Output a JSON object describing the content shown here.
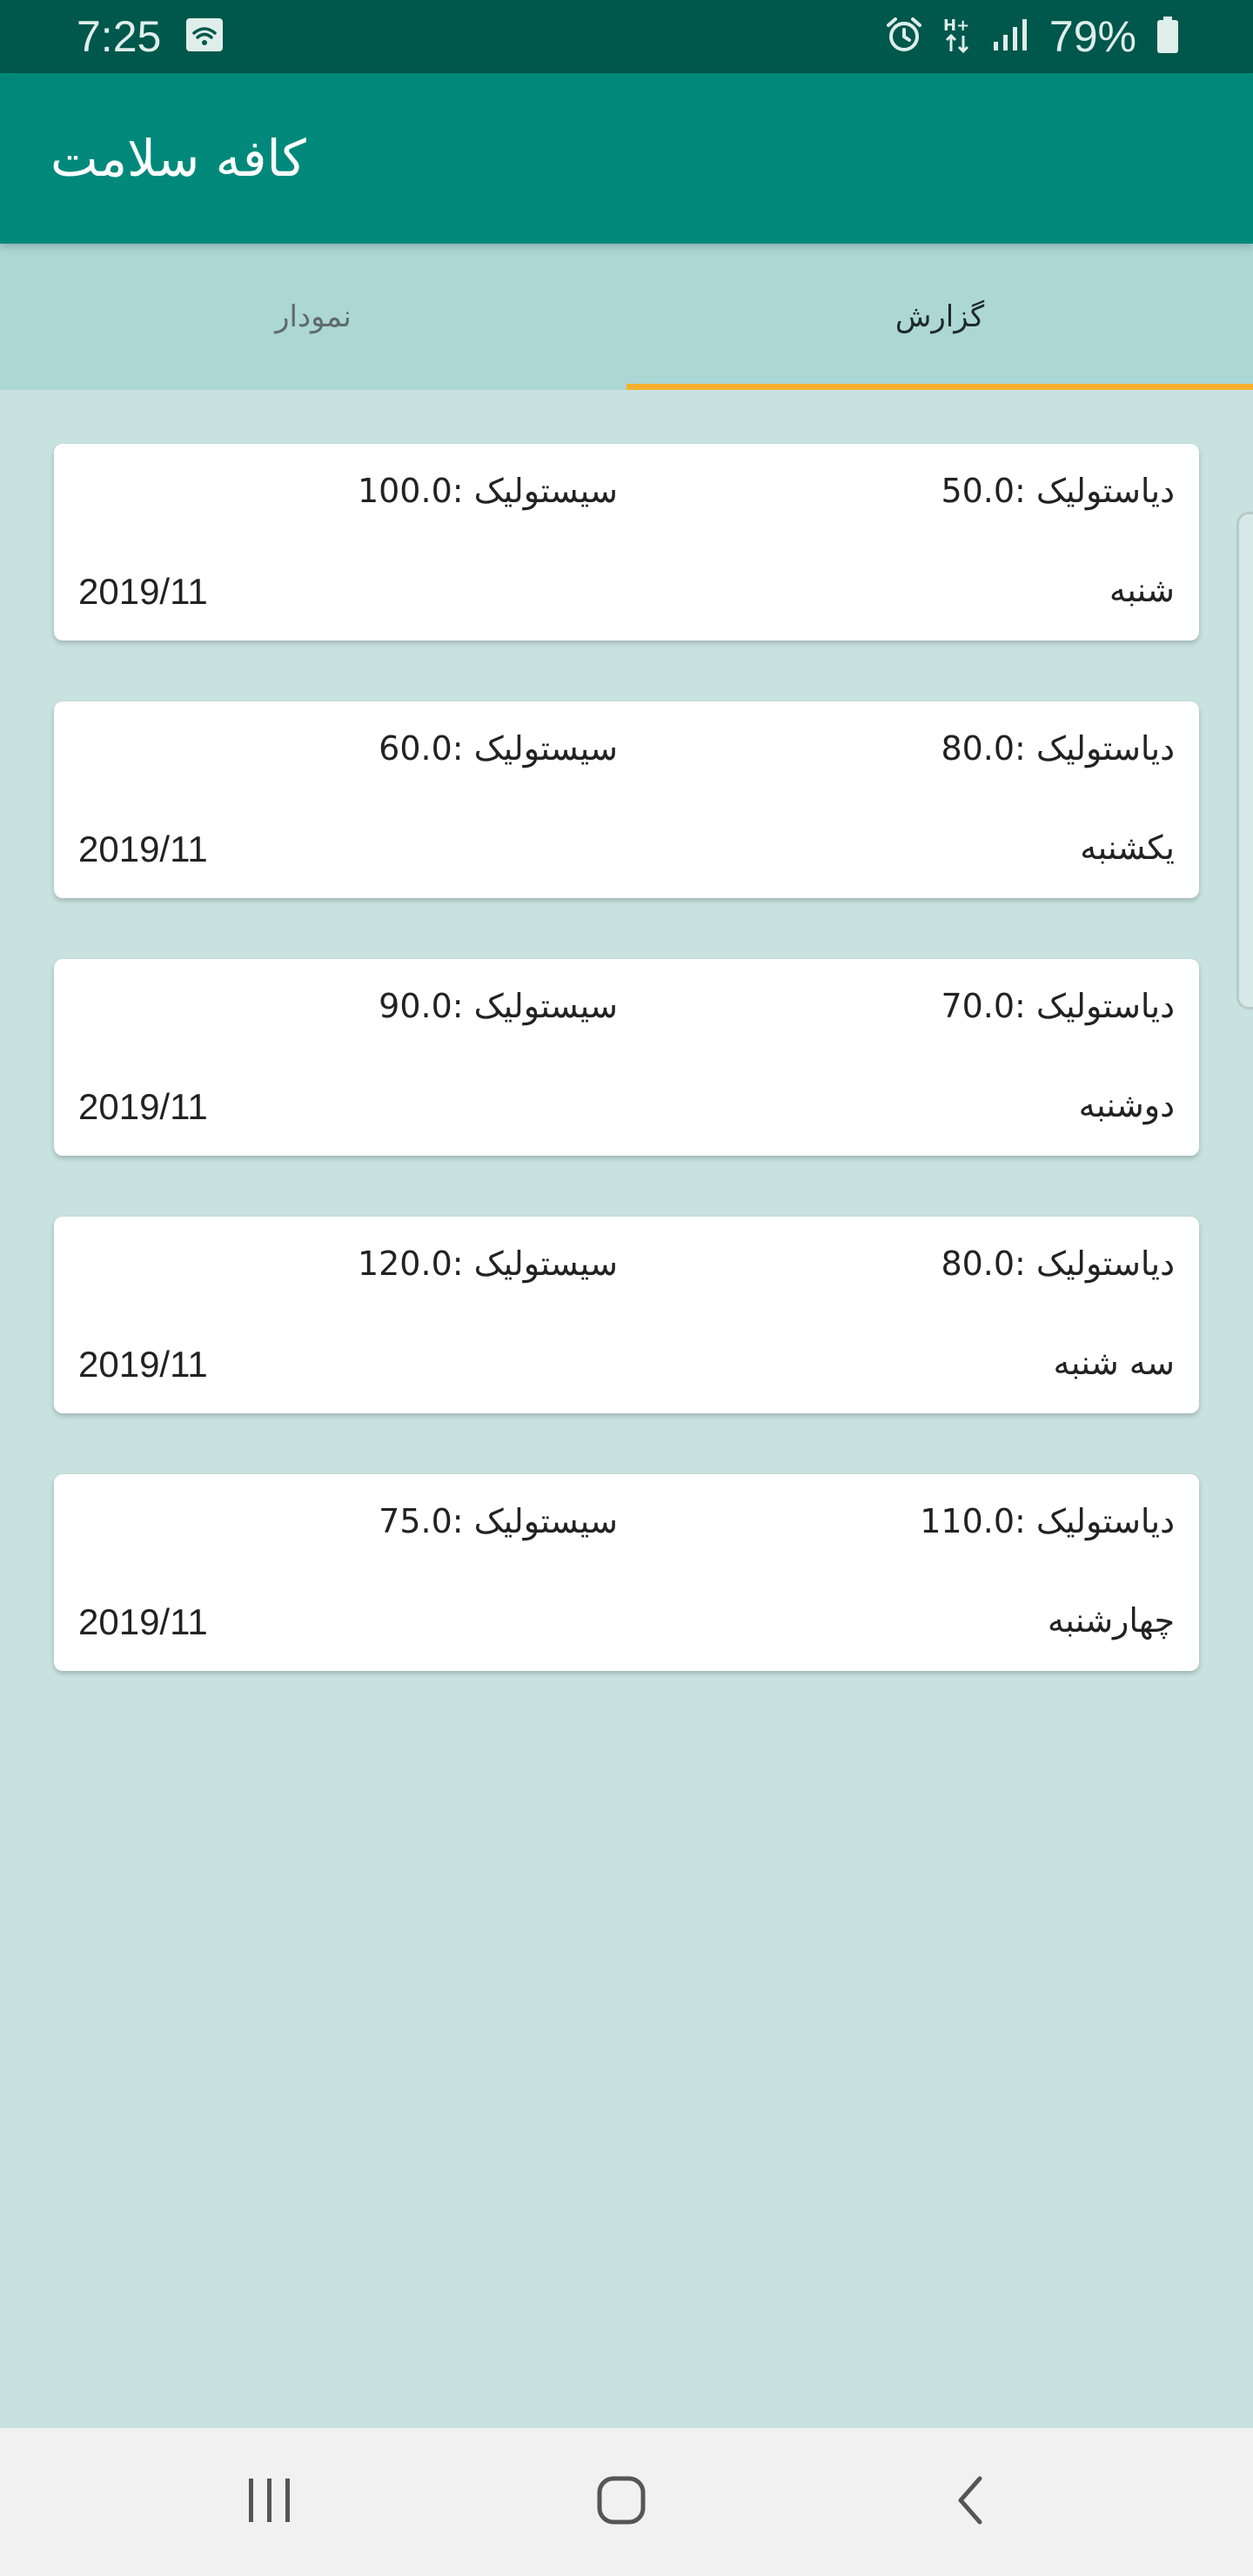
{
  "status_bar": {
    "time": "7:25",
    "battery": "79%",
    "icons": [
      "wifi-call-icon",
      "alarm-icon",
      "hplus-data-icon",
      "signal-icon",
      "battery-icon"
    ]
  },
  "app_bar": {
    "title": "کافه سلامت"
  },
  "tabs": {
    "report": "گزارش",
    "chart": "نمودار",
    "selected": "report",
    "indicator_color": "#f7b02e"
  },
  "records": [
    {
      "diastolic": "دیاستولیک :50.0",
      "systolic": "سیستولیک :100.0",
      "day": "شنبه",
      "date": "2019/11"
    },
    {
      "diastolic": "دیاستولیک :80.0",
      "systolic": "سیستولیک :60.0",
      "day": "یکشنبه",
      "date": "2019/11"
    },
    {
      "diastolic": "دیاستولیک :70.0",
      "systolic": "سیستولیک :90.0",
      "day": "دوشنبه",
      "date": "2019/11"
    },
    {
      "diastolic": "دیاستولیک :80.0",
      "systolic": "سیستولیک :120.0",
      "day": "سه شنبه",
      "date": "2019/11"
    },
    {
      "diastolic": "دیاستولیک :110.0",
      "systolic": "سیستولیک :75.0",
      "day": "چهارشنبه",
      "date": "2019/11"
    }
  ],
  "nav_bar": {
    "buttons": [
      "recents-icon",
      "home-icon",
      "back-icon"
    ]
  },
  "colors": {
    "status_bar": "#00574b",
    "app_bar": "#00897b",
    "tab_bar": "#acd7d4",
    "background": "#c8e2df"
  }
}
